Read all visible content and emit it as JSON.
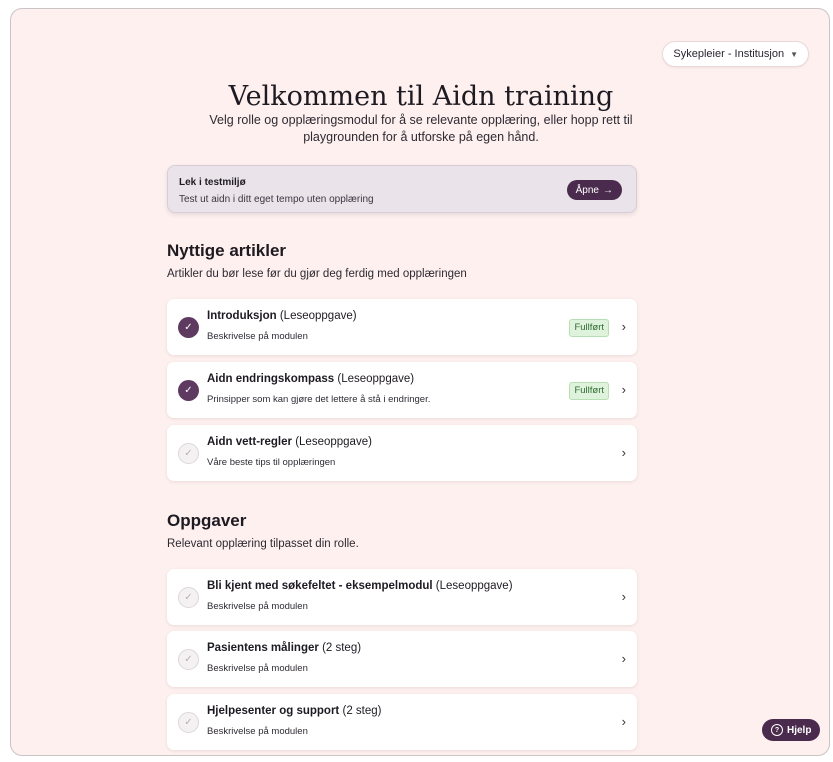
{
  "header": {
    "role_select": "Sykepleier - Institusjon",
    "title": "Velkommen til Aidn training",
    "subtitle": "Velg rolle og opplæringsmodul for å se relevante opplæring, eller hopp rett til playgrounden for å utforske på egen hånd."
  },
  "sandbox": {
    "title": "Lek i testmiljø",
    "desc": "Test ut aidn i ditt eget tempo uten opplæring",
    "button": "Åpne",
    "button_arrow": "→"
  },
  "articles": {
    "title": "Nyttige artikler",
    "subtitle": "Artikler du bør lese før du gjør deg ferdig med opplæringen",
    "items": [
      {
        "name": "Introduksjon",
        "type": "(Leseoppgave)",
        "desc": "Beskrivelse på modulen",
        "badge": "Fullført",
        "done": true
      },
      {
        "name": "Aidn endringskompass",
        "type": "(Leseoppgave)",
        "desc": "Prinsipper som kan gjøre det lettere å stå i endringer.",
        "badge": "Fullført",
        "done": true
      },
      {
        "name": "Aidn vett-regler",
        "type": "(Leseoppgave)",
        "desc": "Våre beste tips til opplæringen",
        "badge": "",
        "done": false
      }
    ]
  },
  "tasks": {
    "title": "Oppgaver",
    "subtitle": "Relevant opplæring tilpasset din rolle.",
    "items": [
      {
        "name": "Bli kjent med søkefeltet - eksempelmodul",
        "type": "(Leseoppgave)",
        "desc": "Beskrivelse på modulen",
        "done": false
      },
      {
        "name": "Pasientens målinger",
        "type": "(2 steg)",
        "desc": "Beskrivelse på modulen",
        "done": false
      },
      {
        "name": "Hjelpesenter og support",
        "type": "(2 steg)",
        "desc": "Beskrivelse på modulen",
        "done": false
      }
    ]
  },
  "help": {
    "label": "Hjelp"
  },
  "icons": {
    "check": "check-icon",
    "chevron": "chevron-right-icon",
    "caret": "caret-down-icon",
    "help": "help-circle-icon"
  },
  "colors": {
    "accent": "#4b2b4d",
    "background": "#fdf0ee",
    "done_badge": "#dff3dc"
  }
}
